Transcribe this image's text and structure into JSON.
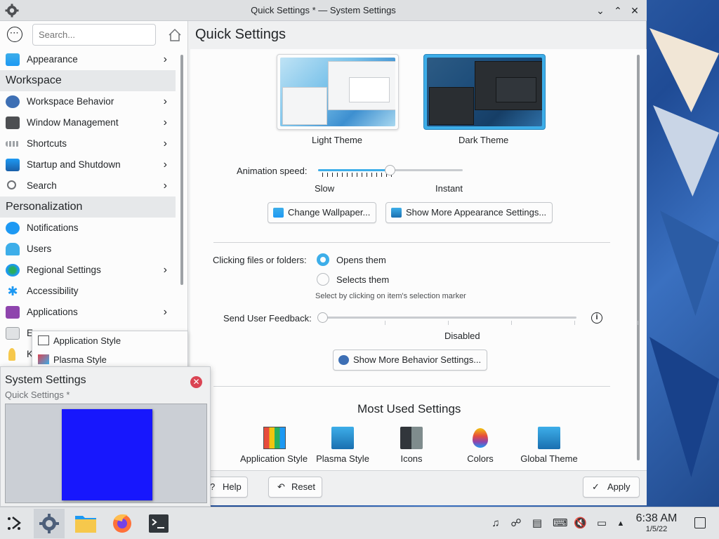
{
  "window": {
    "title": "Quick Settings * — System Settings"
  },
  "sidebar": {
    "search_placeholder": "Search...",
    "items": [
      {
        "label": "Appearance",
        "chevron": true,
        "icon": "appearance-icon"
      },
      {
        "category": "Workspace"
      },
      {
        "label": "Workspace Behavior",
        "chevron": true,
        "icon": "workspace-behavior-icon"
      },
      {
        "label": "Window Management",
        "chevron": true,
        "icon": "window-management-icon"
      },
      {
        "label": "Shortcuts",
        "chevron": true,
        "icon": "shortcuts-icon"
      },
      {
        "label": "Startup and Shutdown",
        "chevron": true,
        "icon": "startup-icon"
      },
      {
        "label": "Search",
        "chevron": true,
        "icon": "search-icon"
      },
      {
        "category": "Personalization"
      },
      {
        "label": "Notifications",
        "chevron": false,
        "icon": "notifications-icon"
      },
      {
        "label": "Users",
        "chevron": false,
        "icon": "users-icon"
      },
      {
        "label": "Regional Settings",
        "chevron": true,
        "icon": "regional-settings-icon"
      },
      {
        "label": "Accessibility",
        "chevron": false,
        "icon": "accessibility-icon"
      },
      {
        "label": "Applications",
        "chevron": true,
        "icon": "applications-icon"
      }
    ],
    "partial": [
      "E",
      "K"
    ]
  },
  "main": {
    "title": "Quick Settings",
    "themes": [
      {
        "label": "Light Theme"
      },
      {
        "label": "Dark Theme"
      }
    ],
    "animation": {
      "label": "Animation speed:",
      "min_label": "Slow",
      "max_label": "Instant",
      "value": 0.5
    },
    "change_wallpaper": "Change Wallpaper...",
    "more_appearance": "Show More Appearance Settings...",
    "clicking": {
      "label": "Clicking files or folders:",
      "option_open": "Opens them",
      "option_select": "Selects them",
      "hint": "Select by clicking on item's selection marker"
    },
    "feedback": {
      "label": "Send User Feedback:",
      "value_label": "Disabled"
    },
    "more_behavior": "Show More Behavior Settings...",
    "most_used": {
      "title": "Most Used Settings",
      "items": [
        {
          "label": "Application Style",
          "icon": "application-style-icon"
        },
        {
          "label": "Plasma Style",
          "icon": "plasma-style-icon"
        },
        {
          "label": "Icons",
          "icon": "icons-icon"
        },
        {
          "label": "Colors",
          "icon": "colors-icon"
        },
        {
          "label": "Global Theme",
          "icon": "global-theme-icon"
        }
      ]
    }
  },
  "footer": {
    "help": "Help",
    "reset": "Reset",
    "apply": "Apply"
  },
  "popup": {
    "items": [
      "Application Style",
      "Plasma Style"
    ]
  },
  "tooltip": {
    "title": "System Settings",
    "subtitle": "Quick Settings *"
  },
  "taskbar": {
    "time": "6:38 AM",
    "date": "1/5/22"
  }
}
